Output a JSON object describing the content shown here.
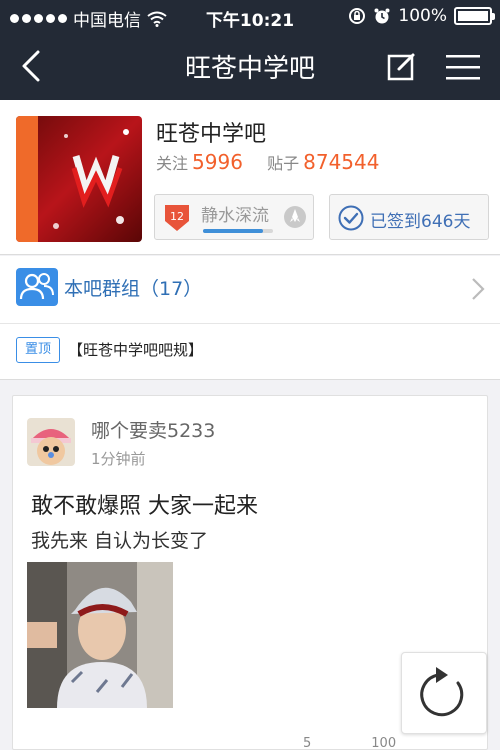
{
  "status": {
    "carrier": "中国电信",
    "time": "下午10:21",
    "battery": "100%"
  },
  "nav": {
    "title": "旺苍中学吧"
  },
  "forum": {
    "name": "旺苍中学吧",
    "follow_label": "关注",
    "follow_count": "5996",
    "posts_label": "贴子",
    "posts_count": "874544",
    "level_number": "12",
    "level_name": "静水深流",
    "level_progress": 0.86,
    "signed_text": "已签到646天"
  },
  "group": {
    "label": "本吧群组（17）"
  },
  "sticky": {
    "tag": "置顶",
    "title": "【旺苍中学吧吧规】"
  },
  "post": {
    "author": "哪个要卖5233",
    "time": "1分钟前",
    "title": "敢不敢爆照 大家一起来",
    "body": "我先来 自认为长变了",
    "likes": "5",
    "comments": "100"
  },
  "colors": {
    "topbar": "#232a36",
    "accent_orange": "#f2602c",
    "accent_blue": "#3a8ee6"
  }
}
